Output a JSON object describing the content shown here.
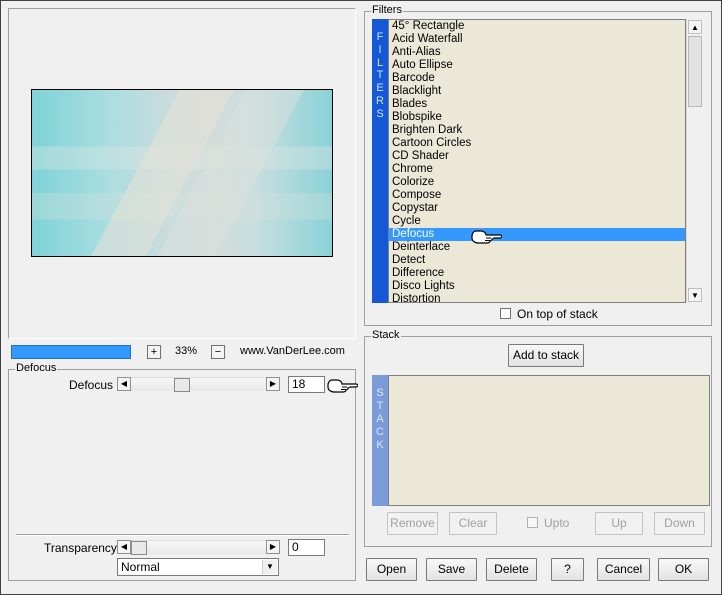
{
  "preview": {
    "zoom_in": "+",
    "zoom_out": "−",
    "zoom_value": "33%",
    "brand": "www.VanDerLee.com"
  },
  "defocus_group": {
    "title": "Defocus",
    "param_label": "Defocus",
    "param_value": "18",
    "slider_fraction": 0.36
  },
  "transparency": {
    "label": "Transparency",
    "value": "0",
    "slider_fraction": 0.0
  },
  "blend_mode": {
    "selected": "Normal"
  },
  "filters_group": {
    "title": "Filters",
    "strip_label": "FILTERS",
    "items": [
      "45° Rectangle",
      "Acid Waterfall",
      "Anti-Alias",
      "Auto Ellipse",
      "Barcode",
      "Blacklight",
      "Blades",
      "Blobspike",
      "Brighten Dark",
      "Cartoon Circles",
      "CD Shader",
      "Chrome",
      "Colorize",
      "Compose",
      "Copystar",
      "Cycle",
      "Defocus",
      "Deinterlace",
      "Detect",
      "Difference",
      "Disco Lights",
      "Distortion"
    ],
    "selected_index": 16,
    "on_top_label": "On top of stack"
  },
  "stack_group": {
    "title": "Stack",
    "add_label": "Add to stack",
    "strip_label": "STACK",
    "remove_label": "Remove",
    "clear_label": "Clear",
    "upto_label": "Upto",
    "up_label": "Up",
    "down_label": "Down"
  },
  "footer": {
    "open": "Open",
    "save": "Save",
    "delete": "Delete",
    "help": "?",
    "cancel": "Cancel",
    "ok": "OK"
  },
  "colors": {
    "selection": "#3399ff",
    "filters_strip": "#1558d6",
    "stack_strip": "#7b9cd8",
    "list_bg": "#ebe8d8"
  }
}
